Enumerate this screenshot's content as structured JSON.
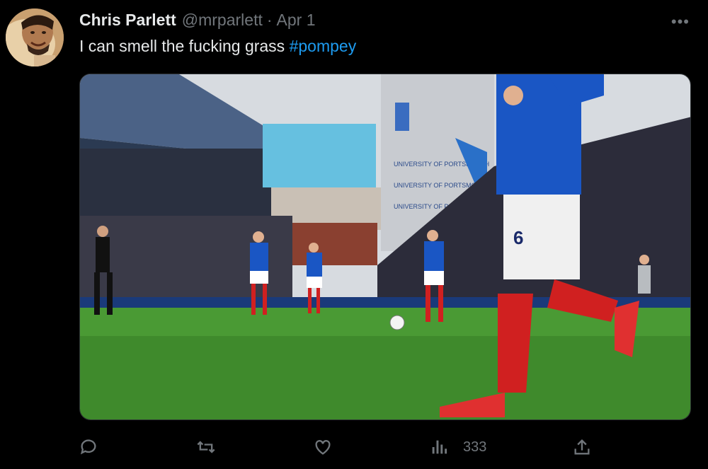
{
  "tweet": {
    "display_name": "Chris Parlett",
    "handle": "@mrparlett",
    "separator": "·",
    "date": "Apr 1",
    "text": "I can smell the fucking grass",
    "hashtag": "#pompey",
    "more_label": "•••"
  },
  "photo": {
    "signage": [
      "UNIVERSITY OF PORTSMOUTH",
      "UNIVERSITY OF PORTSMOUTH",
      "UNIVERSITY OF PORTSMOUTH"
    ],
    "shirt_number": "6"
  },
  "actions": {
    "reply_icon": "reply-icon",
    "retweet_icon": "retweet-icon",
    "like_icon": "heart-icon",
    "views_icon": "views-bar-icon",
    "views_count": "333",
    "share_icon": "share-icon"
  },
  "colors": {
    "background": "#000000",
    "text_primary": "#e7e9ea",
    "text_secondary": "#71767b",
    "link": "#1d9bf0",
    "pompey_blue": "#1a56c4",
    "pitch_green": "#3f8a2c"
  }
}
